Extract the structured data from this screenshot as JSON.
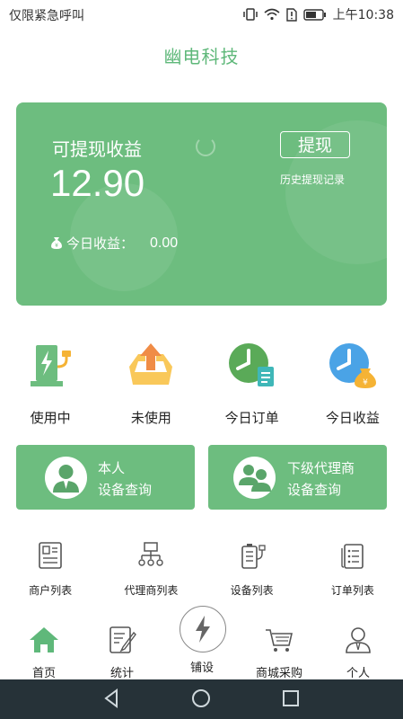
{
  "status_bar": {
    "carrier": "仅限紧急呼叫",
    "time": "上午10:38"
  },
  "app_bar": {
    "title": "幽电科技"
  },
  "earnings_card": {
    "label": "可提现收益",
    "amount": "12.90",
    "today_label": "今日收益：",
    "today_value": "0.00",
    "withdraw_button": "提现",
    "history_link": "历史提现记录",
    "background_color": "#6dbd7f"
  },
  "quick_items": [
    {
      "label": "使用中",
      "icon": "charging-station-icon"
    },
    {
      "label": "未使用",
      "icon": "upload-tray-icon"
    },
    {
      "label": "今日订单",
      "icon": "clock-document-icon"
    },
    {
      "label": "今日收益",
      "icon": "clock-money-icon"
    }
  ],
  "query_buttons": [
    {
      "line1": "本人",
      "line2": "设备查询",
      "icon": "person-icon"
    },
    {
      "line1": "下级代理商",
      "line2": "设备查询",
      "icon": "people-icon"
    }
  ],
  "list_items": [
    {
      "label": "商户列表",
      "icon": "merchant-list-icon"
    },
    {
      "label": "代理商列表",
      "icon": "org-chart-icon"
    },
    {
      "label": "设备列表",
      "icon": "battery-plug-icon"
    },
    {
      "label": "订单列表",
      "icon": "order-list-icon"
    }
  ],
  "tab_bar": {
    "tabs": [
      {
        "label": "首页",
        "icon": "home-icon"
      },
      {
        "label": "统计",
        "icon": "stats-icon"
      },
      {
        "label": "铺设",
        "icon": "lightning-pin-icon"
      },
      {
        "label": "商城采购",
        "icon": "cart-icon"
      },
      {
        "label": "个人",
        "icon": "user-icon"
      }
    ],
    "active_color": "#5fb87a"
  }
}
